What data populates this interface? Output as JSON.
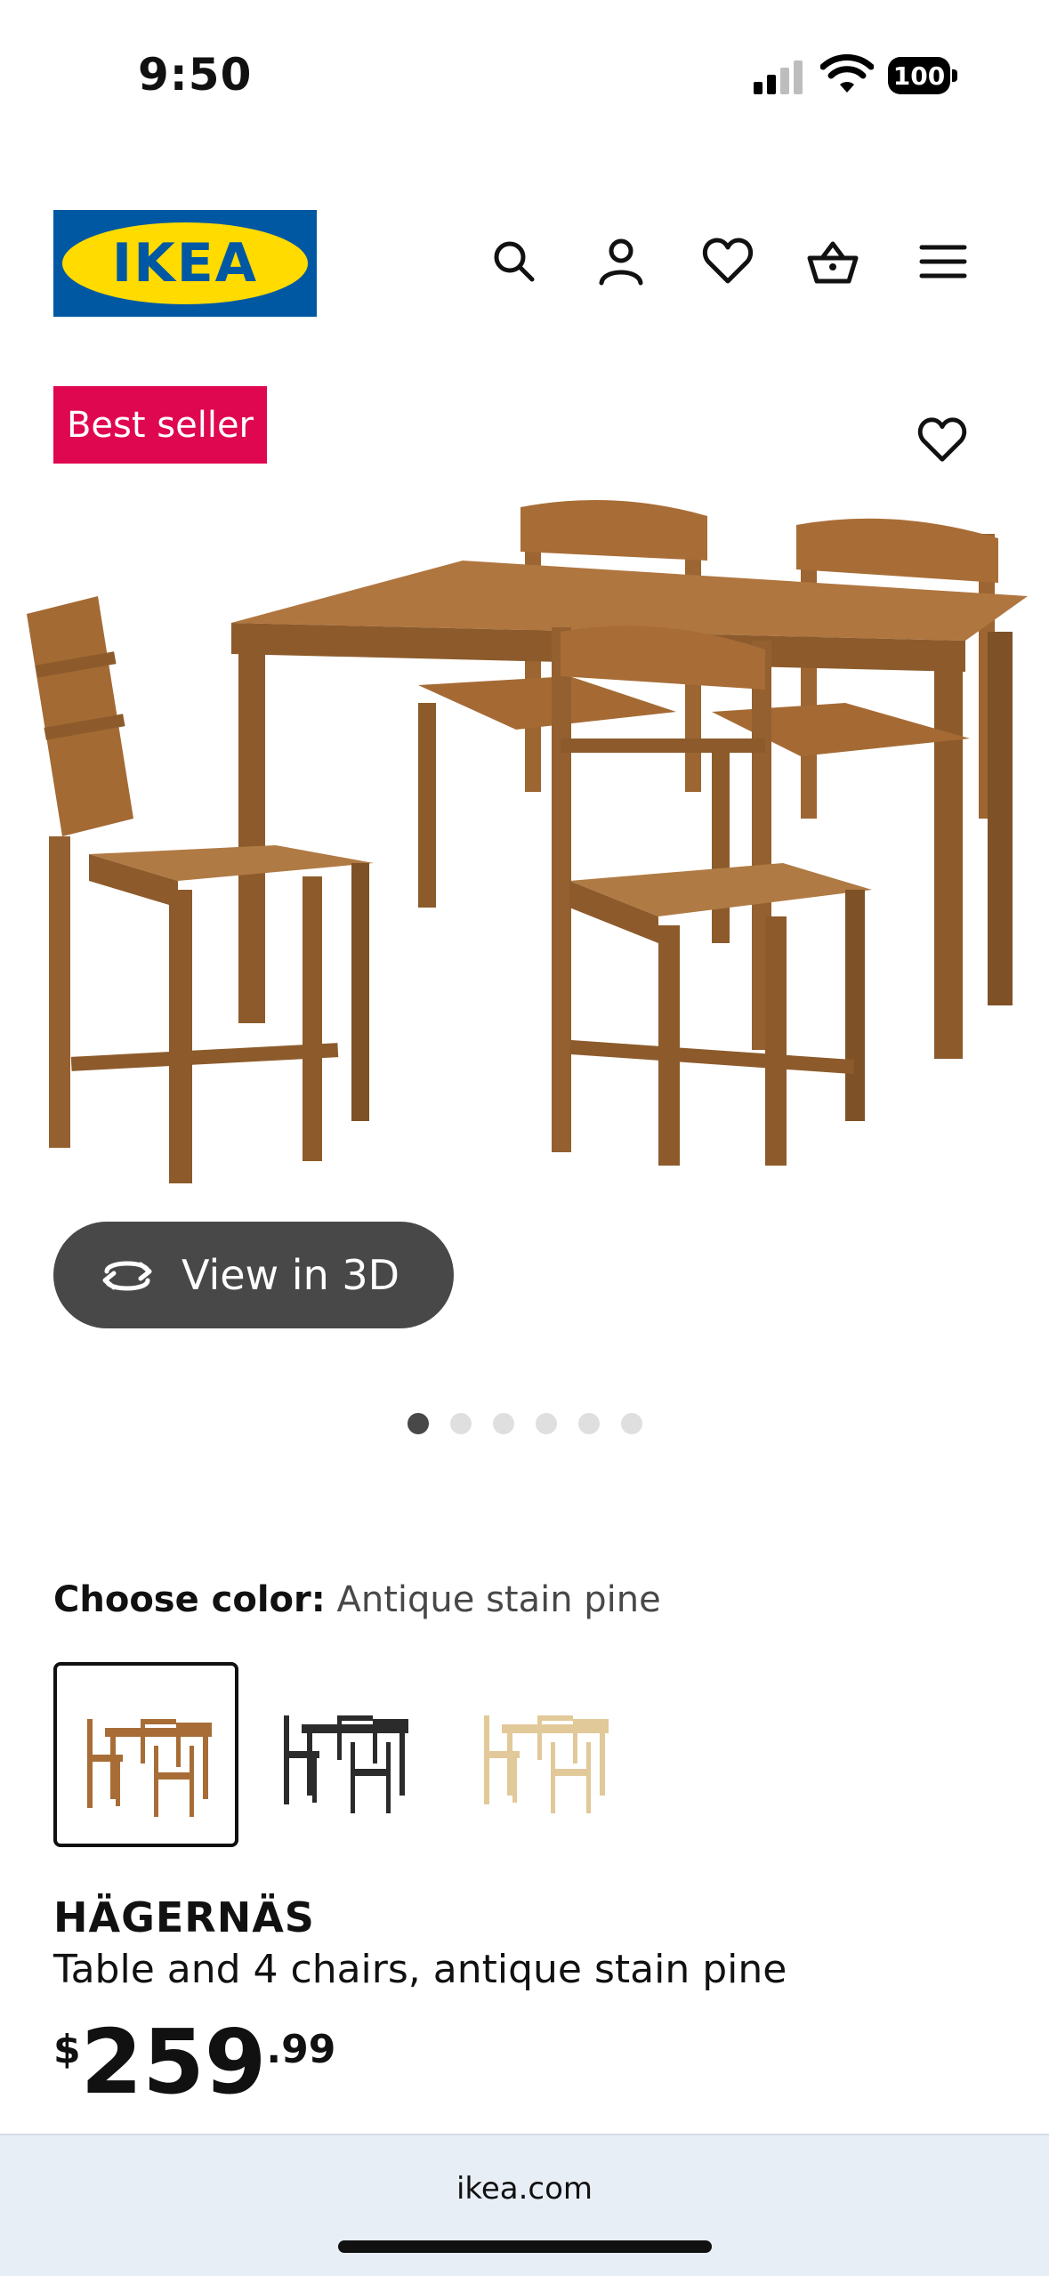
{
  "status_bar": {
    "time": "9:50",
    "battery": "100"
  },
  "header": {
    "logo_text": "IKEA",
    "icons": [
      "search-icon",
      "account-icon",
      "favorites-icon",
      "basket-icon",
      "menu-icon"
    ]
  },
  "product": {
    "badge": "Best seller",
    "view_3d_label": "View in 3D",
    "image_count": 6,
    "active_image": 1,
    "choose_color_label": "Choose color:",
    "selected_color": "Antique stain pine",
    "color_options": [
      "Antique stain pine",
      "black",
      "pine"
    ],
    "name": "HÄGERNÄS",
    "description": "Table and 4 chairs, antique stain pine",
    "price": {
      "currency": "$",
      "integer": "259",
      "decimal": ".99"
    }
  },
  "browser": {
    "url": "ikea.com"
  },
  "colors": {
    "brand_blue": "#0058A3",
    "brand_yellow": "#FFDB00",
    "badge": "#E00751",
    "wood": "#A76B37"
  }
}
